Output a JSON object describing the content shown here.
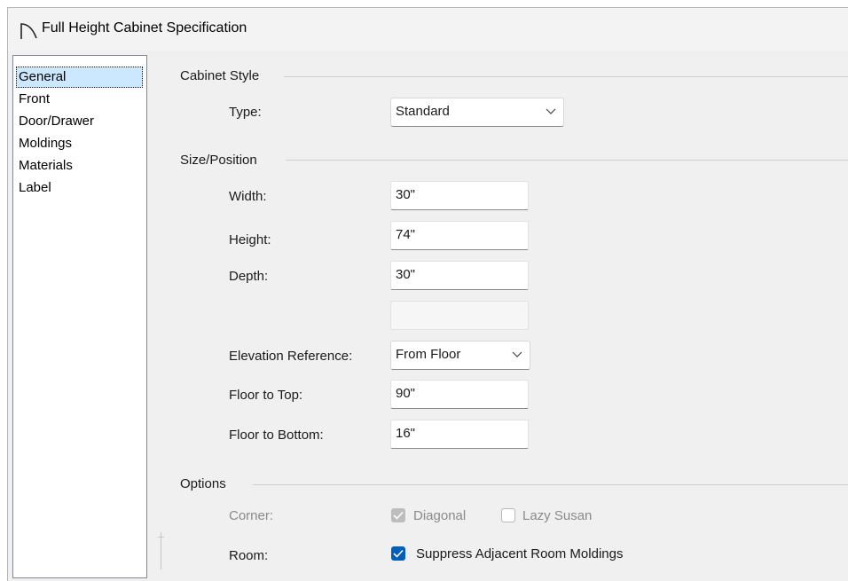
{
  "window": {
    "title": "Full Height Cabinet Specification"
  },
  "nav": {
    "items": [
      "General",
      "Front",
      "Door/Drawer",
      "Moldings",
      "Materials",
      "Label"
    ],
    "selected": "General"
  },
  "cabinet_style": {
    "group_label": "Cabinet Style",
    "type_label": "Type:",
    "type_value": "Standard"
  },
  "size_position": {
    "group_label": "Size/Position",
    "width_label": "Width:",
    "width_value": "30\"",
    "height_label": "Height:",
    "height_value": "74\"",
    "depth_label": "Depth:",
    "depth_value": "30\"",
    "elevation_label": "Elevation Reference:",
    "elevation_value": "From Floor",
    "floor_top_label": "Floor to Top:",
    "floor_top_value": "90\"",
    "floor_bottom_label": "Floor to Bottom:",
    "floor_bottom_value": "16\""
  },
  "options": {
    "group_label": "Options",
    "corner_label": "Corner:",
    "diagonal_label": "Diagonal",
    "diagonal_checked": true,
    "lazy_susan_label": "Lazy Susan",
    "lazy_susan_checked": false,
    "room_label": "Room:",
    "suppress_label": "Suppress Adjacent Room Moldings",
    "suppress_checked": true
  },
  "colors": {
    "accent": "#005fb8",
    "selection": "#cce8ff"
  },
  "icons": {
    "app": "cabinet-arc-icon",
    "dropdown": "chevron-down-icon",
    "check": "checkmark-icon"
  }
}
